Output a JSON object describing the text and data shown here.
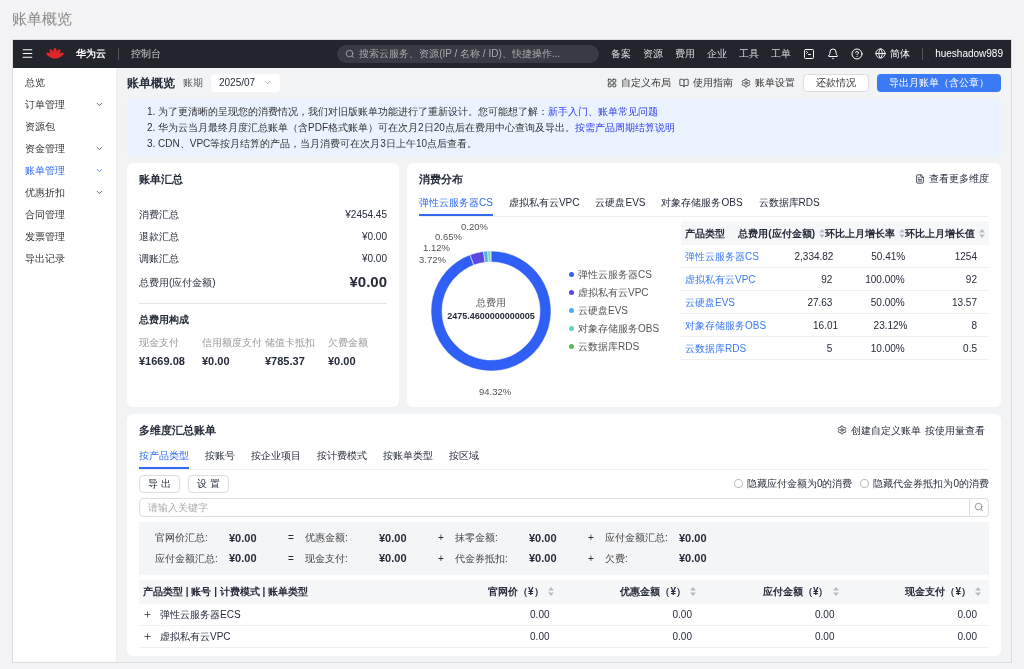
{
  "page_title": "账单概览",
  "topbar": {
    "brand": "华为云",
    "console": "控制台",
    "search": {
      "placeholder": "搜索云服务、资源(IP / 名称 / ID)、快捷操作..."
    },
    "menu": [
      "备案",
      "资源",
      "费用",
      "企业",
      "工具",
      "工单"
    ],
    "language": "简体",
    "user": "hueshadow989"
  },
  "sidebar": {
    "items": [
      {
        "label": "总览",
        "expandable": false,
        "selected": false
      },
      {
        "label": "订单管理",
        "expandable": true,
        "selected": false
      },
      {
        "label": "资源包",
        "expandable": false,
        "selected": false
      },
      {
        "label": "资金管理",
        "expandable": true,
        "selected": false
      },
      {
        "label": "账单管理",
        "expandable": true,
        "selected": true
      },
      {
        "label": "优惠折扣",
        "expandable": true,
        "selected": false
      },
      {
        "label": "合同管理",
        "expandable": false,
        "selected": false
      },
      {
        "label": "发票管理",
        "expandable": false,
        "selected": false
      },
      {
        "label": "导出记录",
        "expandable": false,
        "selected": false
      }
    ]
  },
  "header": {
    "title": "账单概览",
    "period_label": "账期",
    "period": "2025/07",
    "links": [
      {
        "label": "自定义布局",
        "kind": "layout"
      },
      {
        "label": "使用指南",
        "kind": "guide"
      },
      {
        "label": "账单设置",
        "kind": "settings"
      }
    ],
    "buttons": [
      {
        "label": "还款情况",
        "kind": "secondary"
      },
      {
        "label": "导出月账单（含公章）",
        "kind": "primary"
      }
    ]
  },
  "notice": {
    "lines": [
      {
        "text": "1. 为了更清晰的呈现您的消费情况，我们对旧版账单功能进行了重新设计。您可能想了解：",
        "link": "新手入门、账单常见问题"
      },
      {
        "text": "2. 华为云当月最终月度汇总账单（含PDF格式账单）可在次月2日20点后在费用中心查询及导出。",
        "link": "按需产品周期结算说明"
      },
      {
        "text": "3. CDN、VPC等按月结算的产品，当月消费可在次月3日上午10点后查看。"
      }
    ]
  },
  "summary": {
    "title": "账单汇总",
    "rows": [
      {
        "label": "消费汇总",
        "value": "¥2454.45"
      },
      {
        "label": "退款汇总",
        "value": "¥0.00"
      },
      {
        "label": "调账汇总",
        "value": "¥0.00"
      }
    ],
    "total": {
      "label": "总费用(应付金额)",
      "value": "¥0.00"
    },
    "composition": {
      "title": "总费用构成",
      "items": [
        {
          "label": "现金支付",
          "value": "¥1669.08"
        },
        {
          "label": "信用额度支付",
          "value": "¥0.00"
        },
        {
          "label": "储值卡抵扣",
          "value": "¥785.37"
        },
        {
          "label": "欠费金额",
          "value": "¥0.00"
        }
      ]
    }
  },
  "distribution": {
    "title": "消费分布",
    "more_link": "查看更多维度",
    "tabs": [
      {
        "label": "弹性云服务器CS",
        "selected": true
      },
      {
        "label": "虚拟私有云VPC",
        "selected": false
      },
      {
        "label": "云硬盘EVS",
        "selected": false
      },
      {
        "label": "对象存储服务OBS",
        "selected": false
      },
      {
        "label": "云数据库RDS",
        "selected": false
      }
    ],
    "center_value": "2475.4600000000005",
    "chart_data": {
      "type": "donut",
      "categories": [
        "弹性云服务器CS",
        "虚拟私有云VPC",
        "云硬盘EVS",
        "对象存储服务OBS",
        "云数据库RDS"
      ],
      "series": [
        {
          "name": "总费用",
          "values": [
            94.32,
            3.72,
            1.12,
            0.65,
            0.2
          ]
        }
      ],
      "legend": "right",
      "colors": [
        "#2f5ff5",
        "#5a48e6",
        "#4bb0e6",
        "#5fd3c0",
        "#5cb85c"
      ],
      "value_labels": [
        "94.32%",
        "3.72%",
        "1.12%",
        "0.65%",
        "0.20%"
      ]
    },
    "table": {
      "columns": [
        {
          "label": "产品类型",
          "sortable": false
        },
        {
          "label": "总费用(应付金额)",
          "sortable": true
        },
        {
          "label": "环比上月增长率",
          "sortable": true
        },
        {
          "label": "环比上月增长值",
          "sortable": true
        }
      ],
      "rows": [
        [
          "弹性云服务器CS",
          "2,334.82",
          "50.41%",
          "1254"
        ],
        [
          "虚拟私有云VPC",
          "92",
          "100.00%",
          "92"
        ],
        [
          "云硬盘EVS",
          "27.63",
          "50.00%",
          "13.57"
        ],
        [
          "对象存储服务OBS",
          "16.01",
          "23.12%",
          "8"
        ],
        [
          "云数据库RDS",
          "5",
          "10.00%",
          "0.5"
        ]
      ]
    }
  },
  "multi": {
    "title": "多维度汇总账单",
    "actions": [
      "创建自定义账单",
      "按使用量查看"
    ],
    "tabs": [
      {
        "label": "按产品类型",
        "selected": true
      },
      {
        "label": "按账号",
        "selected": false
      },
      {
        "label": "按企业项目",
        "selected": false
      },
      {
        "label": "按计费模式",
        "selected": false
      },
      {
        "label": "按账单类型",
        "selected": false
      },
      {
        "label": "按区域",
        "selected": false
      }
    ],
    "buttons": [
      "导 出",
      "设 置"
    ],
    "checkboxes": [
      {
        "label": "隐藏应付金额为0的消费",
        "checked": false
      },
      {
        "label": "隐藏代金券抵扣为0的消费",
        "checked": false
      }
    ],
    "search": {
      "placeholder": "请输入关键字"
    },
    "formula": [
      [
        {
          "label": "官网价汇总:",
          "value": "¥0.00"
        },
        {
          "op": "=",
          "label": "优惠金额:",
          "value": "¥0.00"
        },
        {
          "op": "+",
          "label": "抹零金额:",
          "value": "¥0.00"
        },
        {
          "op": "+",
          "label": "应付金额汇总:",
          "value": "¥0.00"
        }
      ],
      [
        {
          "label": "应付金额汇总:",
          "value": "¥0.00"
        },
        {
          "op": "=",
          "label": "现金支付:",
          "value": "¥0.00"
        },
        {
          "op": "+",
          "label": "代金券抵扣:",
          "value": "¥0.00"
        },
        {
          "op": "+",
          "label": "欠费:",
          "value": "¥0.00"
        }
      ]
    ],
    "table": {
      "columns": [
        {
          "label": "产品类型 | 账号 | 计费模式 | 账单类型",
          "sortable": false
        },
        {
          "label": "官网价（¥）",
          "sortable": true
        },
        {
          "label": "优惠金额（¥）",
          "sortable": true
        },
        {
          "label": "应付金额（¥）",
          "sortable": true
        },
        {
          "label": "现金支付（¥）",
          "sortable": true
        }
      ],
      "rows": [
        {
          "name": "弹性云服务器ECS",
          "cells": [
            "0.00",
            "0.00",
            "0.00",
            "0.00"
          ]
        },
        {
          "name": "虚拟私有云VPC",
          "cells": [
            "0.00",
            "0.00",
            "0.00",
            "0.00"
          ]
        }
      ]
    }
  }
}
